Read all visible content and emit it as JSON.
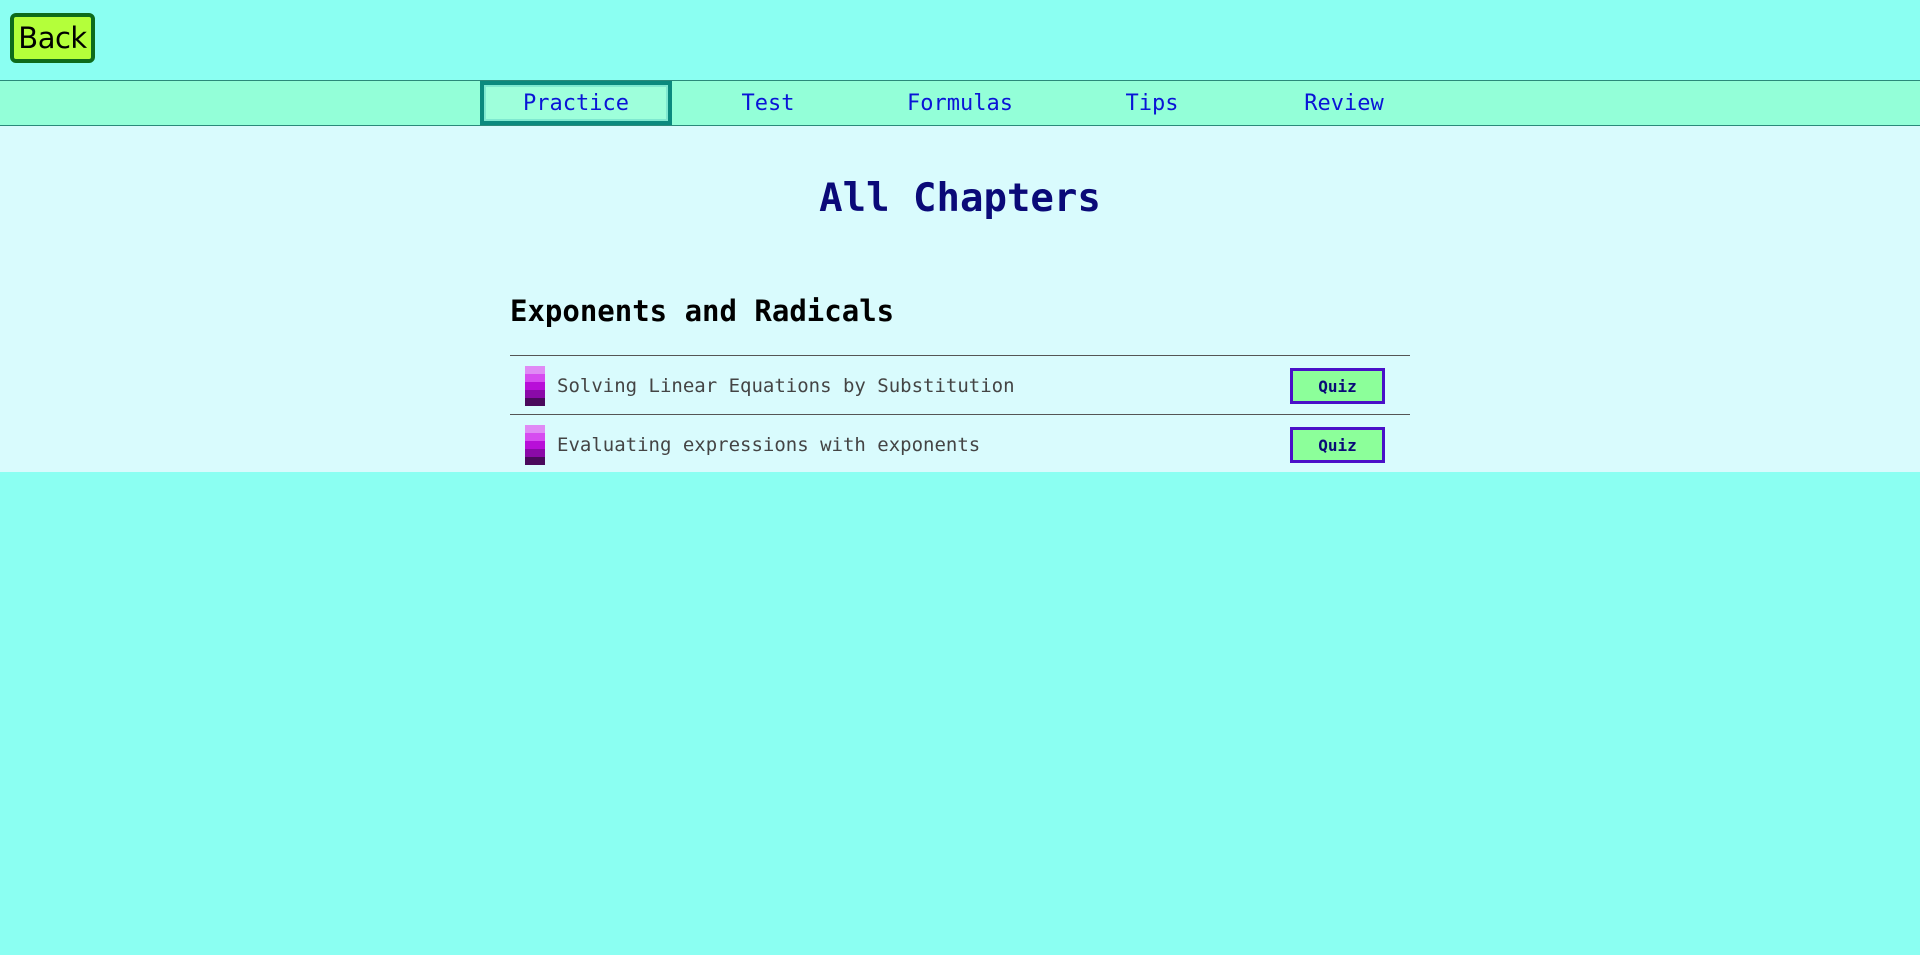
{
  "back_label": "Back",
  "tabs": [
    {
      "label": "Practice",
      "active": true
    },
    {
      "label": "Test",
      "active": false
    },
    {
      "label": "Formulas",
      "active": false
    },
    {
      "label": "Tips",
      "active": false
    },
    {
      "label": "Review",
      "active": false
    }
  ],
  "page_title": "All Chapters",
  "chapter": {
    "title": "Exponents and Radicals",
    "lessons": [
      {
        "label": "Solving Linear Equations by Substitution",
        "icon": "level-bars-icon",
        "action": "Quiz"
      },
      {
        "label": "Evaluating expressions with exponents",
        "icon": "level-bars-icon",
        "action": "Quiz"
      }
    ]
  },
  "colors": {
    "background": "#8bfff2",
    "tab_bar": "#93ffd8",
    "content_bg": "#d9fbfd",
    "back_button": "#b4ff3a",
    "quiz_button": "#8cff9a",
    "quiz_border": "#4a10c8",
    "link_text": "#0a14d6",
    "title_text": "#0a0a78",
    "level_icon_shades": [
      "#e08af5",
      "#d64cf0",
      "#b80fd8",
      "#8a0aa8",
      "#4a0a5c"
    ]
  }
}
